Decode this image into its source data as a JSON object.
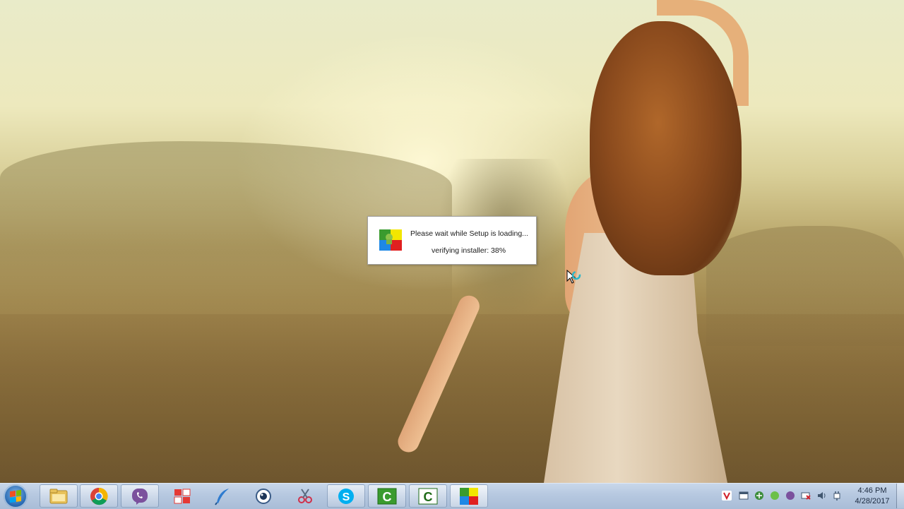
{
  "setup_popup": {
    "message": "Please wait while Setup is loading...",
    "status": "verifying installer: 38%",
    "progress_percent": 38
  },
  "taskbar": {
    "pinned": [
      {
        "name": "Windows Explorer",
        "icon": "folder-icon",
        "active": true
      },
      {
        "name": "Google Chrome",
        "icon": "chrome-icon",
        "active": true
      },
      {
        "name": "Viber",
        "icon": "viber-icon",
        "active": true
      },
      {
        "name": "App",
        "icon": "red-apps-icon",
        "active": false
      },
      {
        "name": "Feather App",
        "icon": "feather-icon",
        "active": false
      },
      {
        "name": "Webcam App",
        "icon": "webcam-icon",
        "active": false
      },
      {
        "name": "Snipping Tool",
        "icon": "scissors-icon",
        "active": false
      },
      {
        "name": "Skype",
        "icon": "skype-icon",
        "active": true
      },
      {
        "name": "Camtasia",
        "icon": "camtasia-icon",
        "active": true
      },
      {
        "name": "Camtasia Recorder",
        "icon": "camtasia-recorder-icon",
        "active": true
      },
      {
        "name": "Setup",
        "icon": "setup-icon",
        "active": true
      }
    ],
    "clock": {
      "time": "4:46 PM",
      "date": "4/28/2017"
    }
  },
  "colors": {
    "taskbar": "#b6c8e0",
    "popup_bg": "#ffffff",
    "skype_blue": "#00aff0",
    "camtasia_green": "#3a9b2e",
    "viber_purple": "#7b519d"
  }
}
